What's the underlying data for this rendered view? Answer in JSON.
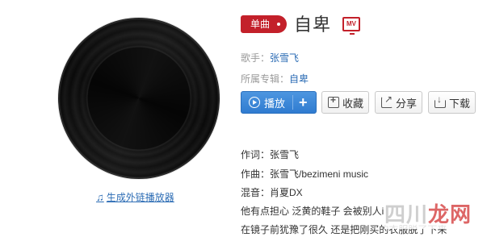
{
  "song": {
    "type_tag": "单曲",
    "title": "自卑",
    "mv_icon_label": "MV"
  },
  "meta": {
    "singer_label": "歌手：",
    "singer": "张雪飞",
    "album_label": "所属专辑：",
    "album": "自卑"
  },
  "actions": {
    "play": "播放",
    "add": "+",
    "collect": "收藏",
    "share": "分享",
    "download": "下载"
  },
  "external_link": {
    "icon": "music-note-icon",
    "label": "生成外链播放器"
  },
  "credits": {
    "lyricist": "作词：张雪飞",
    "composer": "作曲：张雪飞/bezimeni music",
    "mixing": "混音：肖夏DX"
  },
  "lyrics": [
    "他有点担心 泛黄的鞋子 会被别人i",
    "在镜子前犹豫了很久 还是把刚买的衣服脱了下来"
  ],
  "watermark": {
    "part1": "四川",
    "part2": "龙网"
  },
  "colors": {
    "accent_red": "#c3202a",
    "link_blue": "#2d6db5",
    "play_blue": "#2f7bd0"
  }
}
